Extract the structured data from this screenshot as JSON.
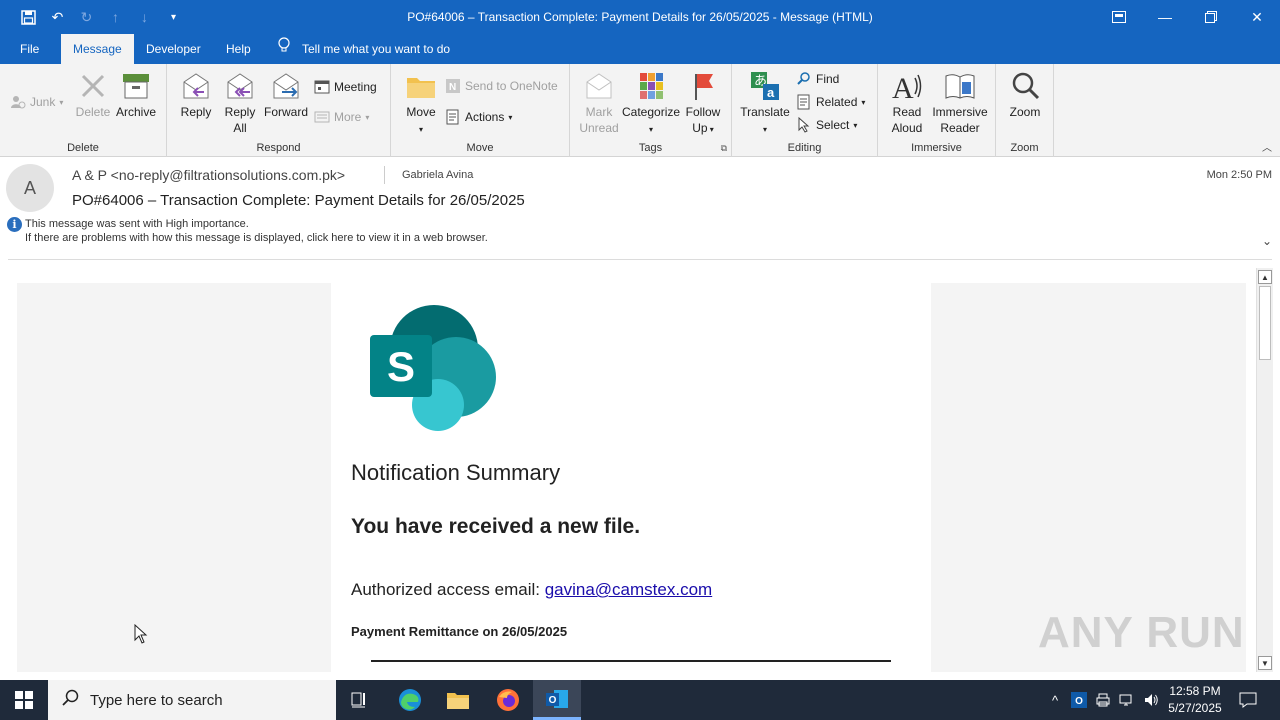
{
  "window": {
    "title": "PO#64006 – Transaction Complete: Payment Details for 26/05/2025  -  Message (HTML)"
  },
  "tabs": [
    {
      "label": "File"
    },
    {
      "label": "Message"
    },
    {
      "label": "Developer"
    },
    {
      "label": "Help"
    }
  ],
  "tell_me": "Tell me what you want to do",
  "ribbon": {
    "delete_group": {
      "label": "Delete",
      "junk": "Junk",
      "delete": "Delete",
      "archive": "Archive"
    },
    "respond_group": {
      "label": "Respond",
      "reply": "Reply",
      "reply_all_1": "Reply",
      "reply_all_2": "All",
      "forward": "Forward",
      "meeting": "Meeting",
      "more": "More"
    },
    "move_group": {
      "label": "Move",
      "move": "Move",
      "send_onenote": "Send to OneNote",
      "actions": "Actions"
    },
    "tags_group": {
      "label": "Tags",
      "mark_unread_1": "Mark",
      "mark_unread_2": "Unread",
      "categorize": "Categorize",
      "follow_up_1": "Follow",
      "follow_up_2": "Up"
    },
    "editing_group": {
      "label": "Editing",
      "translate": "Translate",
      "find": "Find",
      "related": "Related",
      "select": "Select"
    },
    "immersive_group": {
      "label": "Immersive",
      "read_aloud_1": "Read",
      "read_aloud_2": "Aloud",
      "immersive_reader_1": "Immersive",
      "immersive_reader_2": "Reader"
    },
    "zoom_group": {
      "label": "Zoom",
      "zoom": "Zoom"
    }
  },
  "message": {
    "avatar_letter": "A",
    "from": "A & P <no-reply@filtrationsolutions.com.pk>",
    "to": "Gabriela Avina",
    "date": "Mon 2:50 PM",
    "subject": "PO#64006 – Transaction Complete: Payment Details for 26/05/2025",
    "info_line1": "This message was sent with High importance.",
    "info_line2": "If there are problems with how this message is displayed, click here to view it in a web browser."
  },
  "body": {
    "logo_letter": "S",
    "notification_title": "Notification Summary",
    "received_text": "You have received a new file.",
    "auth_label": "Authorized access email: ",
    "auth_email": "gavina@camstex.com",
    "remittance": "Payment Remittance on 26/05/2025"
  },
  "watermark": "ANY RUN",
  "taskbar": {
    "search_placeholder": "Type here to search",
    "time": "12:58 PM",
    "date": "5/27/2025"
  },
  "colors": {
    "accent": "#1565c0",
    "taskbar": "#1f2a3a",
    "link": "#1a0dab"
  }
}
